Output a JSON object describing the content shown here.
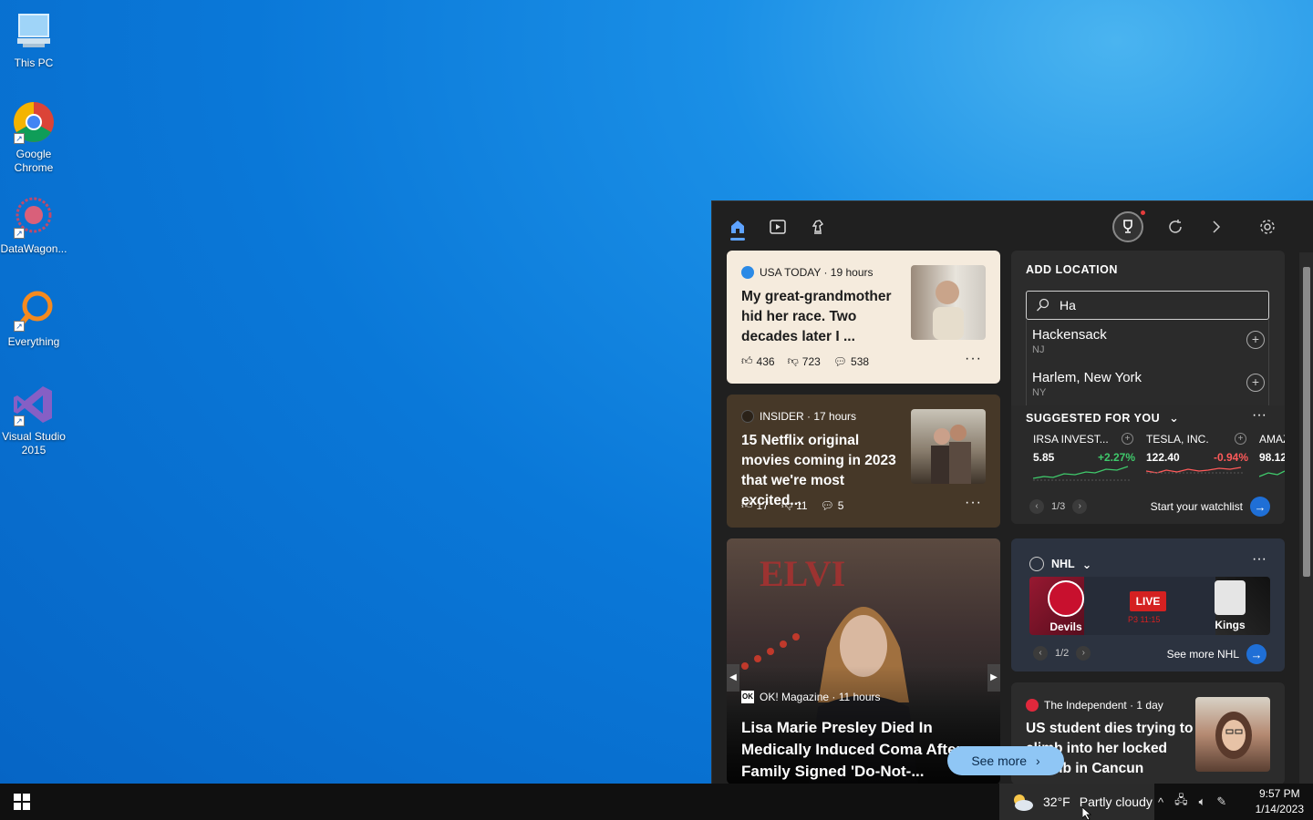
{
  "desktop": {
    "icons": [
      {
        "label": "This PC"
      },
      {
        "label": "Google Chrome"
      },
      {
        "label": "DataWagon..."
      },
      {
        "label": "Everything"
      },
      {
        "label": "Visual Studio 2015"
      }
    ]
  },
  "news1": {
    "source": "USA TODAY · 19 hours",
    "title": "My great-grandmother hid her race. Two decades later I ...",
    "likes": "436",
    "dislikes": "723",
    "comments": "538",
    "more": "···"
  },
  "news2": {
    "source": "INSIDER · 17 hours",
    "title": "15 Netflix original movies coming in 2023 that we're most excited...",
    "likes": "17",
    "dislikes": "11",
    "comments": "5",
    "more": "···"
  },
  "big_story": {
    "source": "OK! Magazine · 11 hours",
    "title_line1": "Lisa Marie Presley Died In",
    "title_line2": "Medically Induced Coma After",
    "title_line3": "Family Signed 'Do-Not-...",
    "source_badge": "OK"
  },
  "weather": {
    "heading": "ADD LOCATION",
    "search_value": "Ha",
    "suggestions": [
      {
        "name": "Hackensack",
        "sub": "NJ"
      },
      {
        "name": "Harlem, New York",
        "sub": "NY"
      }
    ]
  },
  "suggested": {
    "heading": "SUGGESTED FOR YOU",
    "more": "···",
    "stocks": [
      {
        "name": "IRSA INVEST...",
        "price": "5.85",
        "change": "+2.27%",
        "color": "#3fc96b"
      },
      {
        "name": "TESLA, INC.",
        "price": "122.40",
        "change": "-0.94%",
        "color": "#ff5a5a"
      },
      {
        "name": "AMAZ",
        "price": "98.12",
        "change": "",
        "color": "#3fc96b"
      }
    ],
    "page": "1/3",
    "cta": "Start your watchlist"
  },
  "nhl": {
    "heading": "NHL",
    "more": "···",
    "home_team": "Devils",
    "away_team": "Kings",
    "live": "LIVE",
    "period": "P3 11:15",
    "page": "1/2",
    "cta": "See more NHL"
  },
  "news3": {
    "source": "The Independent · 1 day",
    "title": "US student dies trying to climb into her locked Airbnb in Cancun"
  },
  "see_more": "See more",
  "taskbar": {
    "temp": "32°F",
    "condition": "Partly cloudy",
    "time": "9:57 PM",
    "date": "1/14/2023"
  },
  "colors": {
    "accent": "#5ea3ff",
    "up": "#3fc96b",
    "down": "#ff5a5a",
    "live": "#d42121"
  }
}
